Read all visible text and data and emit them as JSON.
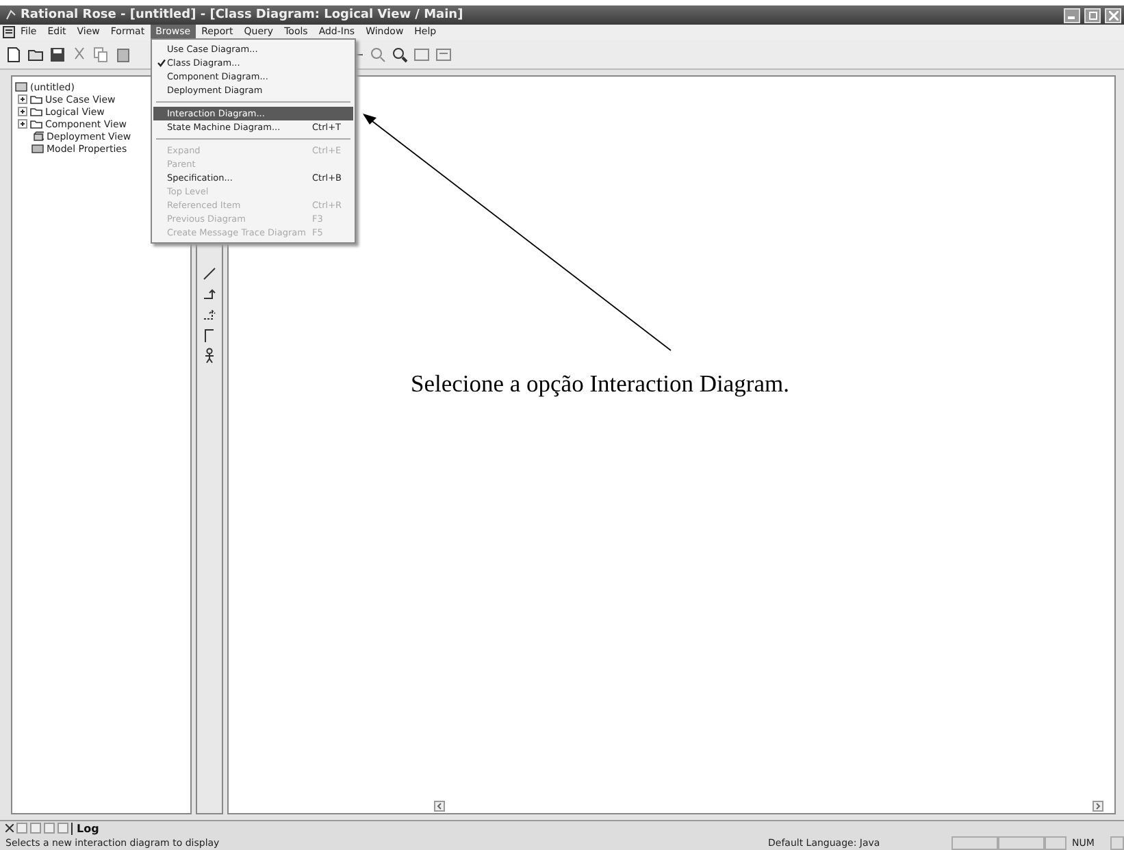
{
  "window": {
    "title": "Rational Rose - [untitled] - [Class Diagram: Logical View / Main]"
  },
  "menu_bar": [
    {
      "label": "File",
      "selected": false
    },
    {
      "label": "Edit",
      "selected": false
    },
    {
      "label": "View",
      "selected": false
    },
    {
      "label": "Format",
      "selected": false
    },
    {
      "label": "Browse",
      "selected": true
    },
    {
      "label": "Report",
      "selected": false
    },
    {
      "label": "Query",
      "selected": false
    },
    {
      "label": "Tools",
      "selected": false
    },
    {
      "label": "Add-Ins",
      "selected": false
    },
    {
      "label": "Window",
      "selected": false
    },
    {
      "label": "Help",
      "selected": false
    }
  ],
  "browse_menu": [
    {
      "kind": "item",
      "label": "Use Case Diagram...",
      "checked": false,
      "selected": false,
      "disabled": false
    },
    {
      "kind": "item",
      "label": "Class Diagram...",
      "checked": true,
      "selected": false,
      "disabled": false
    },
    {
      "kind": "item",
      "label": "Component Diagram...",
      "checked": false,
      "selected": false,
      "disabled": false
    },
    {
      "kind": "item",
      "label": "Deployment Diagram",
      "checked": false,
      "selected": false,
      "disabled": false
    },
    {
      "kind": "separator"
    },
    {
      "kind": "item",
      "label": "Interaction Diagram...",
      "checked": false,
      "selected": true,
      "disabled": false
    },
    {
      "kind": "item",
      "label": "State Machine Diagram...",
      "shortcut": "Ctrl+T",
      "checked": false,
      "selected": false,
      "disabled": false
    },
    {
      "kind": "separator"
    },
    {
      "kind": "item",
      "label": "Expand",
      "shortcut": "Ctrl+E",
      "checked": false,
      "selected": false,
      "disabled": true
    },
    {
      "kind": "item",
      "label": "Parent",
      "checked": false,
      "selected": false,
      "disabled": true
    },
    {
      "kind": "item",
      "label": "Specification...",
      "shortcut": "Ctrl+B",
      "checked": false,
      "selected": false,
      "disabled": false
    },
    {
      "kind": "item",
      "label": "Top Level",
      "checked": false,
      "selected": false,
      "disabled": true
    },
    {
      "kind": "item",
      "label": "Referenced Item",
      "shortcut": "Ctrl+R",
      "checked": false,
      "selected": false,
      "disabled": true
    },
    {
      "kind": "item",
      "label": "Previous Diagram",
      "shortcut": "F3",
      "checked": false,
      "selected": false,
      "disabled": true
    },
    {
      "kind": "item",
      "label": "Create Message Trace Diagram",
      "shortcut": "F5",
      "checked": false,
      "selected": false,
      "disabled": true
    }
  ],
  "browser_tree": {
    "label": "(untitled)",
    "children": [
      {
        "label": "Use Case View",
        "kind": "package",
        "expanded": false
      },
      {
        "label": "Logical View",
        "kind": "package",
        "expanded": false
      },
      {
        "label": "Component View",
        "kind": "package",
        "expanded": false
      },
      {
        "label": "Deployment View",
        "kind": "deployment"
      },
      {
        "label": "Model Properties",
        "kind": "properties"
      }
    ]
  },
  "annotation": {
    "text": "Selecione a opção Interaction Diagram."
  },
  "log_tab": {
    "label": "Log",
    "selected": true
  },
  "status_bar": {
    "message": "Selects a new interaction diagram to display",
    "language": "Default Language: Java",
    "num": "NUM"
  }
}
